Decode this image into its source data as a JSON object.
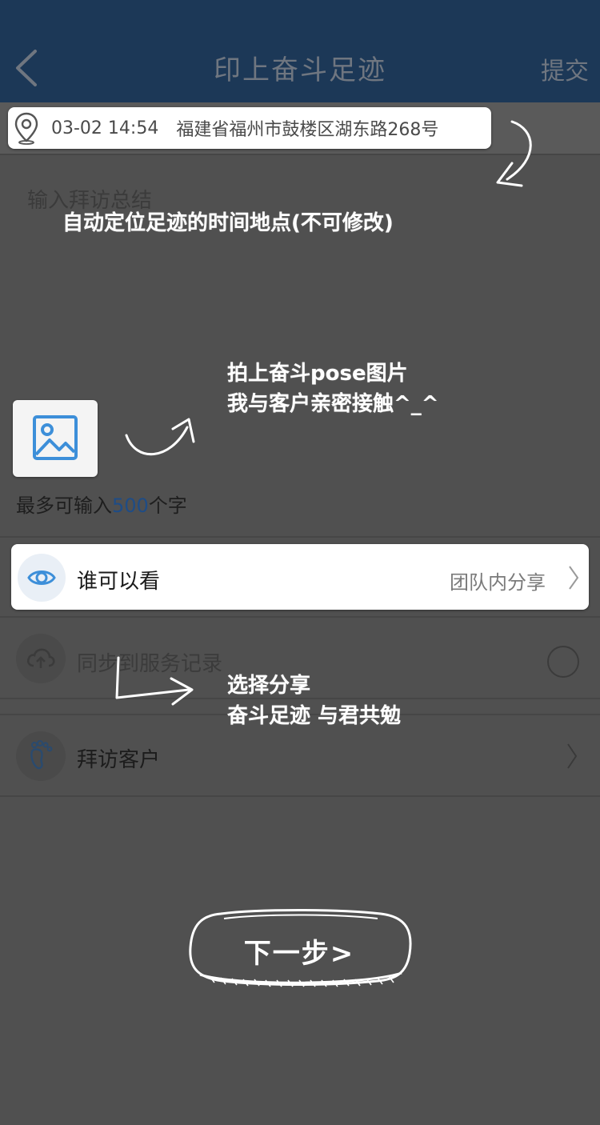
{
  "header": {
    "title": "印上奋斗足迹",
    "submit_label": "提交",
    "back_icon": "chevron-left-icon"
  },
  "location": {
    "time": "03-02 14:54",
    "address": "福建省福州市鼓楼区湖东路268号",
    "icon": "location-pin-icon"
  },
  "summary": {
    "placeholder": "输入拜访总结",
    "char_limit_prefix": "最多可输入",
    "char_limit_value": "500",
    "char_limit_suffix": "个字",
    "photo_icon": "image-icon"
  },
  "visibility": {
    "label": "谁可以看",
    "value": "团队内分享",
    "icon": "eye-icon"
  },
  "sync": {
    "label": "同步到服务记录",
    "icon": "cloud-upload-icon",
    "checked": false
  },
  "visit": {
    "label": "拜访客户",
    "icon": "footprint-icon"
  },
  "annotations": {
    "location_note": "自动定位足迹的时间地点(不可修改)",
    "photo_note_line1": "拍上奋斗pose图片",
    "photo_note_line2": "我与客户亲密接触^_^",
    "share_note_line1": "选择分享",
    "share_note_line2": "奋斗足迹 与君共勉",
    "next_step": "下一步>"
  },
  "colors": {
    "header_bg": "#1c3857",
    "overlay_bg": "#505050",
    "accent_blue": "#3d8fd9",
    "char_count": "#1e4c86"
  }
}
